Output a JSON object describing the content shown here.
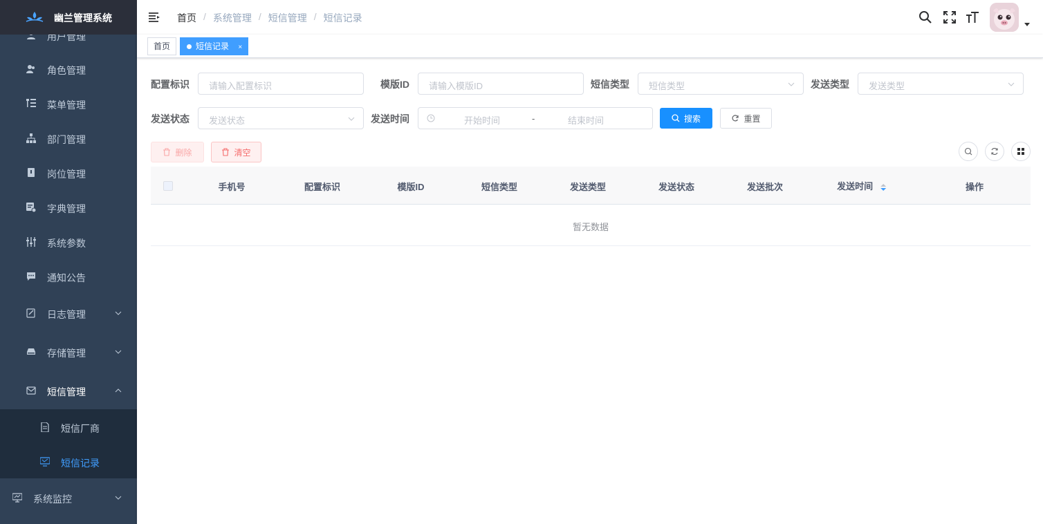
{
  "app": {
    "title": "幽兰管理系统"
  },
  "sidebar": {
    "items": [
      {
        "label": "用户管理",
        "icon": "user-icon"
      },
      {
        "label": "角色管理",
        "icon": "peoples-icon"
      },
      {
        "label": "菜单管理",
        "icon": "tree-table-icon"
      },
      {
        "label": "部门管理",
        "icon": "tree-icon"
      },
      {
        "label": "岗位管理",
        "icon": "post-icon"
      },
      {
        "label": "字典管理",
        "icon": "dict-icon"
      },
      {
        "label": "系统参数",
        "icon": "edit-icon"
      },
      {
        "label": "通知公告",
        "icon": "message-icon"
      },
      {
        "label": "日志管理",
        "icon": "log-icon"
      },
      {
        "label": "存储管理",
        "icon": "storage-icon"
      },
      {
        "label": "短信管理",
        "icon": "sms-icon"
      },
      {
        "label": "短信厂商",
        "icon": "document-icon"
      },
      {
        "label": "短信记录",
        "icon": "record-icon"
      },
      {
        "label": "系统监控",
        "icon": "monitor-icon"
      }
    ]
  },
  "breadcrumb": [
    "首页",
    "系统管理",
    "短信管理",
    "短信记录"
  ],
  "tags": {
    "home": "首页",
    "active": "短信记录",
    "close": "×"
  },
  "form": {
    "config_label": "配置标识",
    "config_placeholder": "请输入配置标识",
    "template_label": "模版ID",
    "template_placeholder": "请输入模版ID",
    "sms_type_label": "短信类型",
    "sms_type_placeholder": "短信类型",
    "send_type_label": "发送类型",
    "send_type_placeholder": "发送类型",
    "send_status_label": "发送状态",
    "send_status_placeholder": "发送状态",
    "send_time_label": "发送时间",
    "start_placeholder": "开始时间",
    "range_sep": "-",
    "end_placeholder": "结束时间",
    "search_label": "搜索",
    "reset_label": "重置"
  },
  "toolbar": {
    "delete_label": "删除",
    "clear_label": "清空"
  },
  "table": {
    "columns": [
      "手机号",
      "配置标识",
      "模版ID",
      "短信类型",
      "发送类型",
      "发送状态",
      "发送批次",
      "发送时间",
      "操作"
    ],
    "empty_text": "暂无数据"
  },
  "colors": {
    "sidebar_bg": "#304156",
    "accent": "#409eff",
    "danger": "#f56c6c"
  }
}
